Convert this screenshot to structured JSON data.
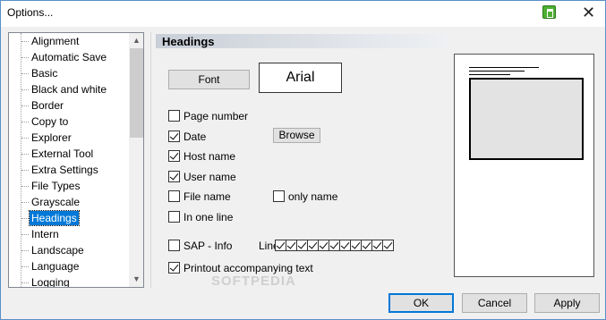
{
  "window": {
    "title": "Options...",
    "close_glyph": "✕"
  },
  "tree": {
    "items": [
      "Alignment",
      "Automatic Save",
      "Basic",
      "Black and white",
      "Border",
      "Copy to",
      "Explorer",
      "External Tool",
      "Extra Settings",
      "File Types",
      "Grayscale",
      "Headings",
      "Intern",
      "Landscape",
      "Language",
      "Logging"
    ],
    "selected": "Headings"
  },
  "panel": {
    "heading": "Headings",
    "font_button": "Font",
    "font_preview": "Arial",
    "browse_button": "Browse",
    "options": {
      "page_number": {
        "label": "Page number",
        "checked": false
      },
      "date": {
        "label": "Date",
        "checked": true
      },
      "host_name": {
        "label": "Host name",
        "checked": true
      },
      "user_name": {
        "label": "User name",
        "checked": true
      },
      "file_name": {
        "label": "File name",
        "checked": false
      },
      "only_name": {
        "label": "only name",
        "checked": false
      },
      "in_one_line": {
        "label": "In one line",
        "checked": false
      },
      "sap_info": {
        "label": "SAP - Info",
        "checked": false
      },
      "printout_text": {
        "label": "Printout accompanying text",
        "checked": true
      }
    },
    "line_label": "Line:",
    "line_checks": [
      true,
      true,
      true,
      true,
      true,
      true,
      true,
      true,
      true,
      true,
      true
    ]
  },
  "footer": {
    "ok": "OK",
    "cancel": "Cancel",
    "apply": "Apply"
  },
  "watermark": "SOFTPEDIA",
  "icons": {
    "app": "printer-icon",
    "close": "close-icon",
    "scroll_up": "chevron-up-icon",
    "scroll_down": "chevron-down-icon"
  }
}
